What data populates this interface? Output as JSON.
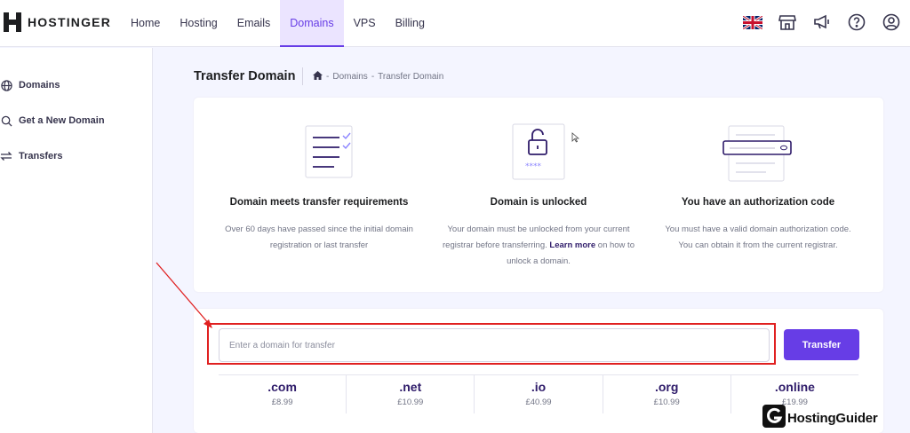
{
  "brand": {
    "name": "HOSTINGER"
  },
  "nav": {
    "items": [
      {
        "label": "Home"
      },
      {
        "label": "Hosting"
      },
      {
        "label": "Emails"
      },
      {
        "label": "Domains",
        "active": true
      },
      {
        "label": "VPS"
      },
      {
        "label": "Billing"
      }
    ]
  },
  "top_icons": [
    "uk-flag-icon",
    "store-icon",
    "megaphone-icon",
    "help-icon",
    "account-icon"
  ],
  "sidebar": {
    "items": [
      {
        "label": "Domains",
        "icon": "globe-icon"
      },
      {
        "label": "Get a New Domain",
        "icon": "search-icon"
      },
      {
        "label": "Transfers",
        "icon": "transfer-arrows-icon"
      }
    ]
  },
  "header": {
    "title": "Transfer Domain",
    "breadcrumb": [
      "Domains",
      "Transfer Domain"
    ],
    "breadcrumb_sep": "-"
  },
  "requirements": [
    {
      "title": "Domain meets transfer requirements",
      "desc": "Over 60 days have passed since the initial domain registration or last transfer",
      "icon": "checklist-icon"
    },
    {
      "title": "Domain is unlocked",
      "desc_before": "Your domain must be unlocked from your current registrar before transferring. ",
      "desc_link": "Learn more",
      "desc_after": " on how to unlock a domain.",
      "icon": "padlock-icon"
    },
    {
      "title": "You have an authorization code",
      "desc": "You must have a valid domain authorization code. You can obtain it from the current registrar.",
      "icon": "password-field-icon"
    }
  ],
  "transfer": {
    "placeholder": "Enter a domain for transfer",
    "value": "",
    "button_label": "Transfer"
  },
  "tlds": [
    {
      "name": ".com",
      "price": "£8.99"
    },
    {
      "name": ".net",
      "price": "£10.99"
    },
    {
      "name": ".io",
      "price": "£40.99"
    },
    {
      "name": ".org",
      "price": "£10.99"
    },
    {
      "name": ".online",
      "price": "£19.99"
    }
  ],
  "watermark": {
    "text": "HostingGuider"
  },
  "colors": {
    "accent": "#673de6",
    "annotation": "#e02020",
    "text_dark": "#1d1e20"
  }
}
